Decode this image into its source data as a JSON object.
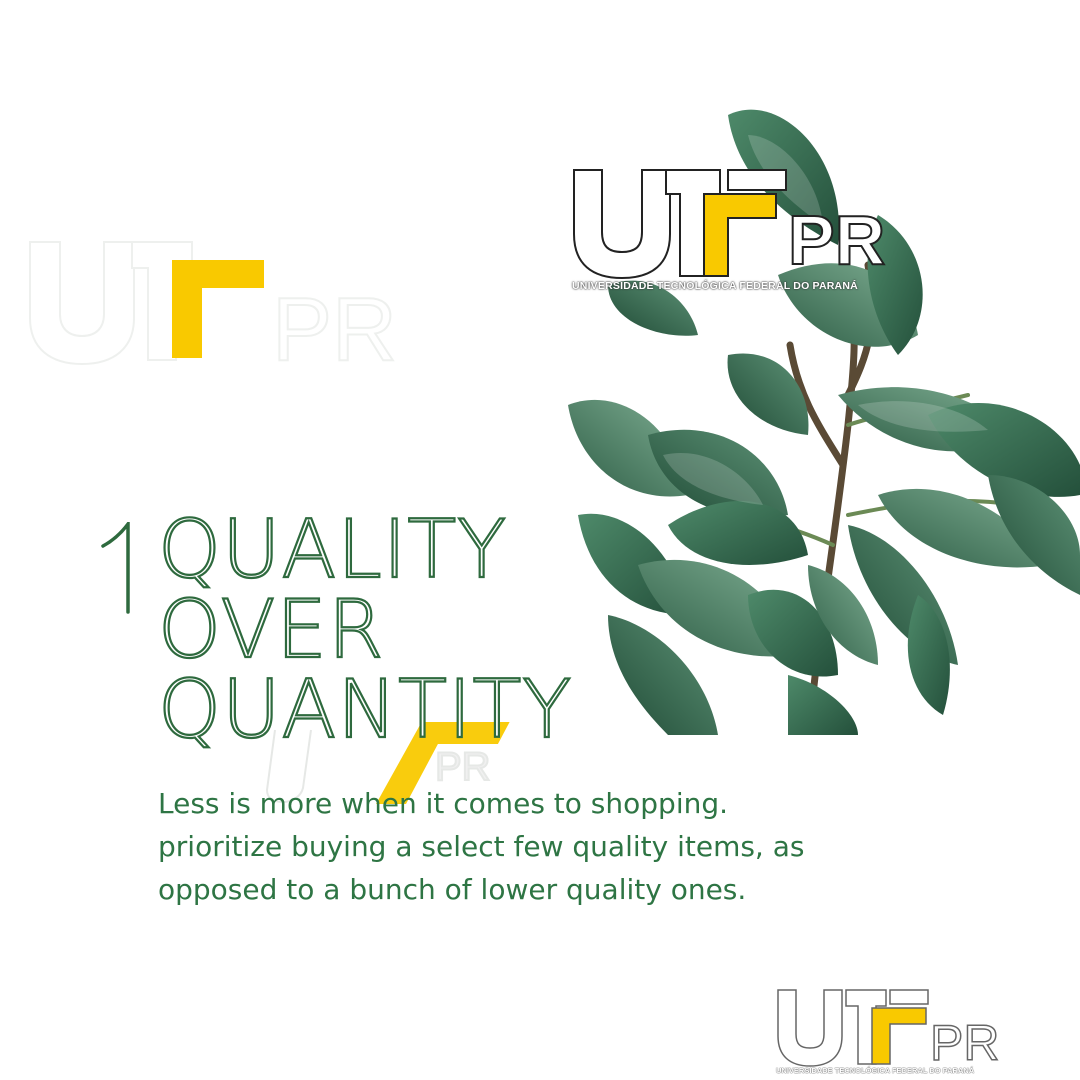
{
  "headline": {
    "number": "1",
    "lines": [
      "QUALITY",
      "OVER",
      "QUANTITY"
    ]
  },
  "body": {
    "text": "Less is more when it comes to shopping. prioritize buying a select few quality items, as opposed to a bunch of lower quality ones."
  },
  "logo": {
    "letters_left": "U",
    "letters_right": "PR",
    "caption": "UNIVERSIDADE TECNOLÓGICA FEDERAL DO PARANÁ"
  },
  "colors": {
    "accent_yellow": "#f9c900",
    "text_green": "#2e7544",
    "leaf_dark": "#2f5e46",
    "leaf_light": "#6a9b80"
  },
  "icons": {
    "plant": "rubber-plant-illustration",
    "logo": "utfpr-logo"
  }
}
